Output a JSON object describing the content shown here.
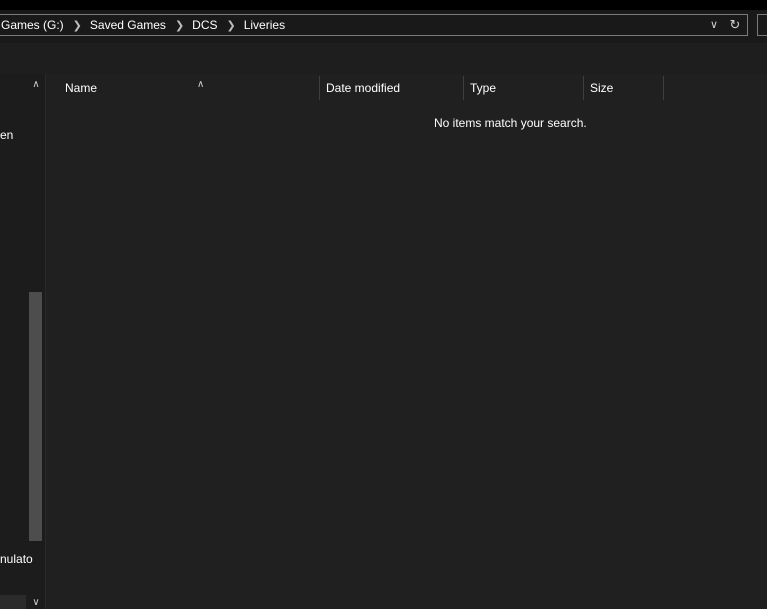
{
  "address_bar": {
    "breadcrumbs": [
      "Games (G:)",
      "Saved Games",
      "DCS",
      "Liveries"
    ],
    "separator_icon": "chevron-right-icon",
    "dropdown_icon": "chevron-down-icon",
    "refresh_icon": "refresh-icon"
  },
  "nav_pane": {
    "items": [
      "en",
      "nulato"
    ]
  },
  "file_list": {
    "columns": [
      "Name",
      "Date modified",
      "Type",
      "Size"
    ],
    "sorted_column": "Name",
    "empty_message": "No items match your search."
  },
  "colors": {
    "background": "#191919",
    "content_background": "#202020",
    "border": "#7a7a7a",
    "text": "#ffffff"
  }
}
